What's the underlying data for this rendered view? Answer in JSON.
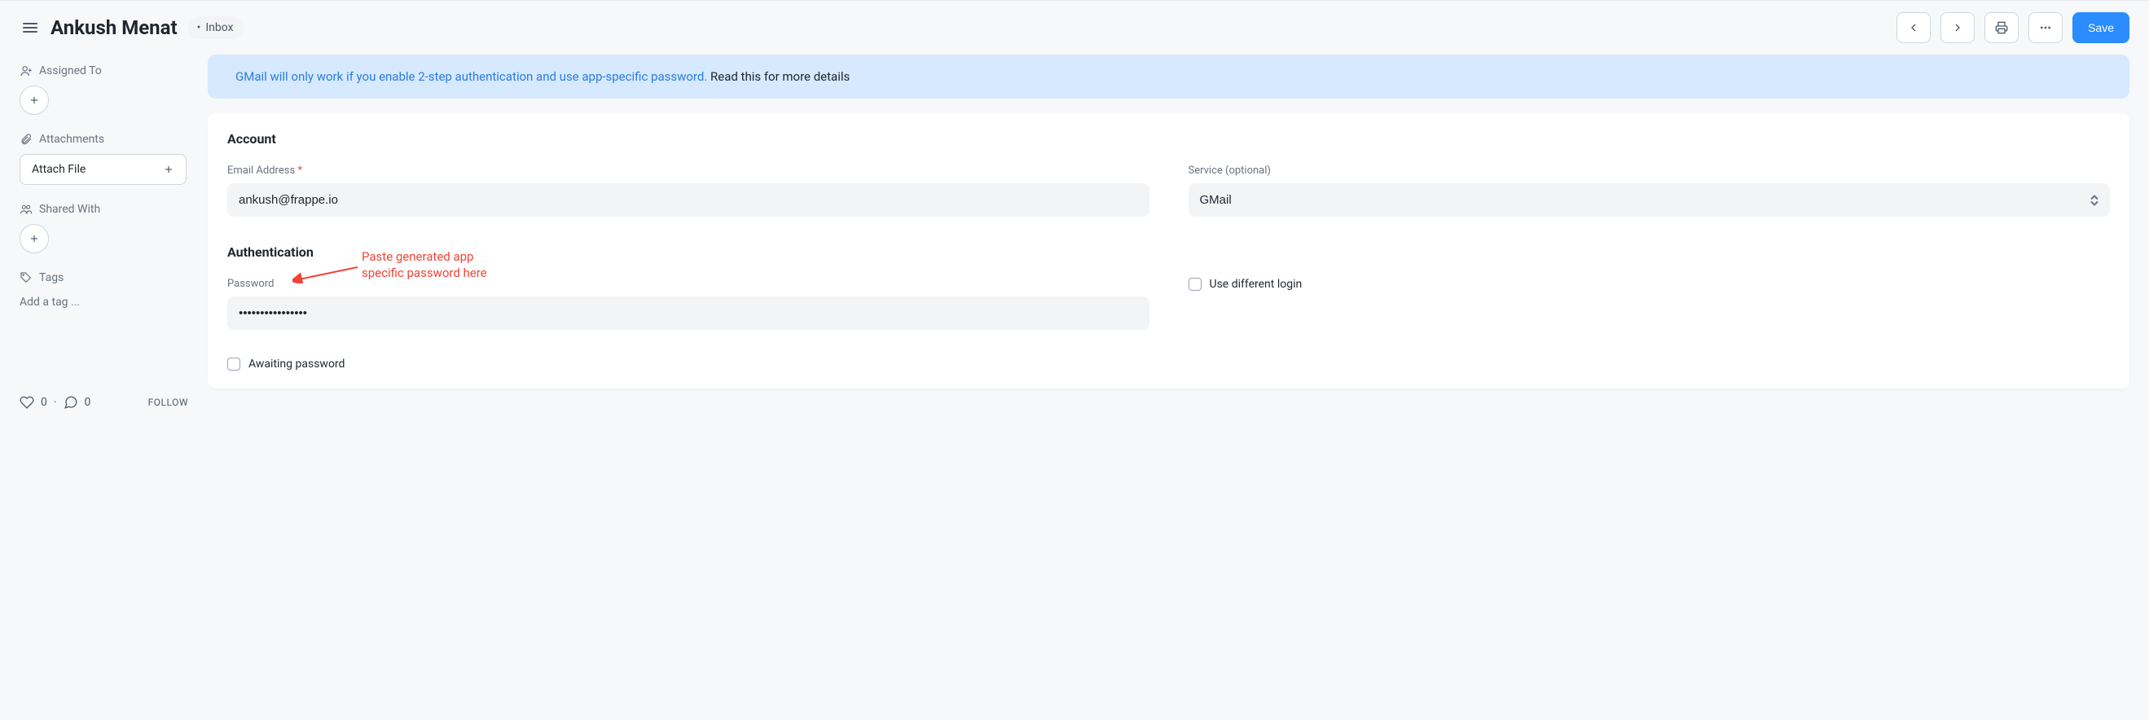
{
  "header": {
    "title": "Ankush Menat",
    "badge": "Inbox",
    "save": "Save"
  },
  "sidebar": {
    "assigned_to": "Assigned To",
    "attachments": "Attachments",
    "attach_file": "Attach File",
    "shared_with": "Shared With",
    "tags": "Tags",
    "add_tag": "Add a tag ...",
    "likes": "0",
    "comments": "0",
    "follow": "FOLLOW"
  },
  "alert": {
    "blue_text": "GMail will only work if you enable 2-step authentication and use app-specific password.",
    "dark_text": "Read this for more details"
  },
  "form": {
    "account_section": "Account",
    "email_label": "Email Address",
    "email_value": "ankush@frappe.io",
    "service_label": "Service (optional)",
    "service_value": "GMail",
    "auth_section": "Authentication",
    "password_label": "Password",
    "password_value": "••••••••••••••••",
    "use_different_login": "Use different login",
    "awaiting_password": "Awaiting password"
  },
  "annotation": {
    "line1": "Paste generated app",
    "line2": "specific password here"
  }
}
